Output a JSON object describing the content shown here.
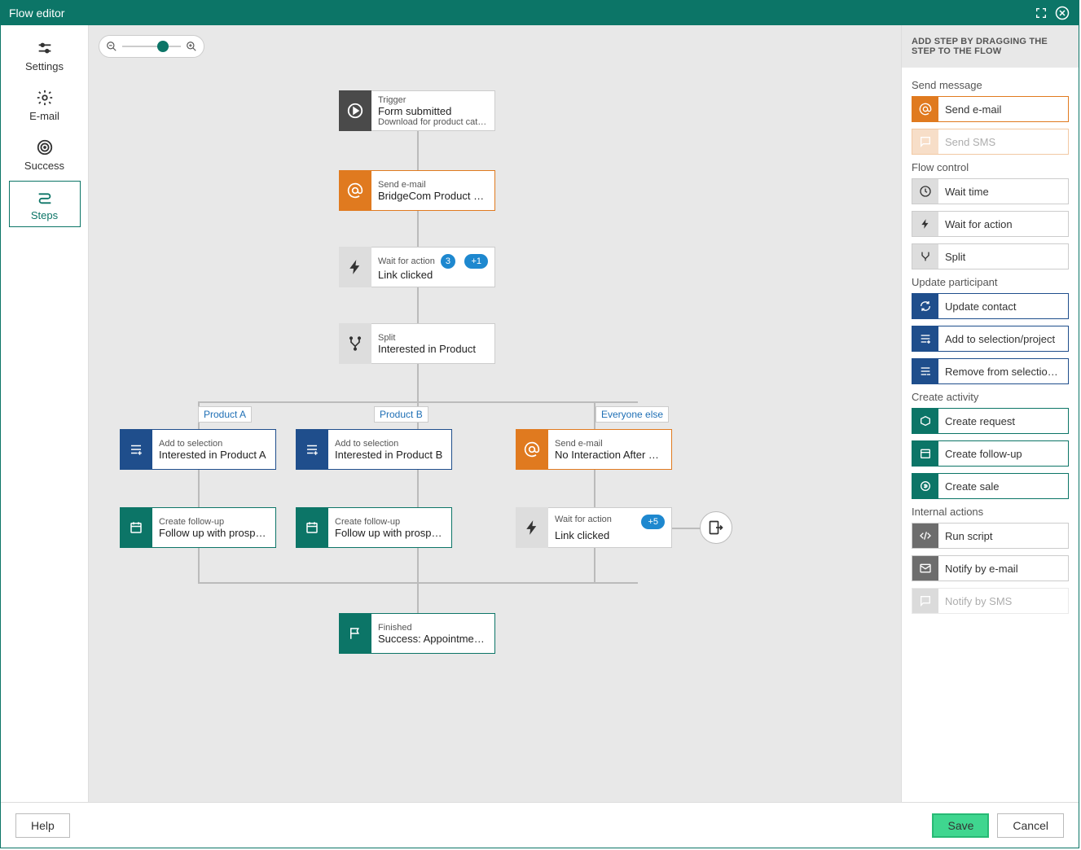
{
  "title": "Flow editor",
  "leftnav": {
    "settings": "Settings",
    "email": "E-mail",
    "success": "Success",
    "steps": "Steps"
  },
  "flow": {
    "trigger": {
      "small1": "Trigger",
      "main": "Form submitted",
      "small2": "Download for product catalog"
    },
    "send_email1": {
      "small": "Send e-mail",
      "main": "BridgeCom Product Cata..."
    },
    "wait_action1": {
      "small": "Wait for action",
      "main": "Link clicked",
      "badge_count": "3",
      "badge_pill": "+1"
    },
    "split": {
      "small": "Split",
      "main": "Interested in Product"
    },
    "branch_labels": {
      "a": "Product A",
      "b": "Product B",
      "c": "Everyone else"
    },
    "branch_a_add": {
      "small": "Add to selection",
      "main": "Interested in Product A"
    },
    "branch_b_add": {
      "small": "Add to selection",
      "main": "Interested in Product B"
    },
    "branch_c_email": {
      "small": "Send e-mail",
      "main": "No Interaction After Cata..."
    },
    "branch_a_fu": {
      "small": "Create follow-up",
      "main": "Follow up with prospect ..."
    },
    "branch_b_fu": {
      "small": "Create follow-up",
      "main": "Follow up with prospect ..."
    },
    "branch_c_wait": {
      "small": "Wait for action",
      "main": "Link clicked",
      "badge_pill": "+5"
    },
    "finished": {
      "small": "Finished",
      "main": "Success: Appointment cr..."
    }
  },
  "panel": {
    "header": "ADD STEP BY DRAGGING THE STEP TO THE FLOW",
    "send_message": {
      "title": "Send message",
      "send_email": "Send e-mail",
      "send_sms": "Send SMS"
    },
    "flow_control": {
      "title": "Flow control",
      "wait_time": "Wait time",
      "wait_action": "Wait for action",
      "split": "Split"
    },
    "update_participant": {
      "title": "Update participant",
      "update_contact": "Update contact",
      "add_selection": "Add to selection/project",
      "remove_selection": "Remove from selection/..."
    },
    "create_activity": {
      "title": "Create activity",
      "create_request": "Create request",
      "create_followup": "Create follow-up",
      "create_sale": "Create sale"
    },
    "internal_actions": {
      "title": "Internal actions",
      "run_script": "Run script",
      "notify_email": "Notify by e-mail",
      "notify_sms": "Notify by SMS"
    }
  },
  "footer": {
    "help": "Help",
    "save": "Save",
    "cancel": "Cancel"
  }
}
